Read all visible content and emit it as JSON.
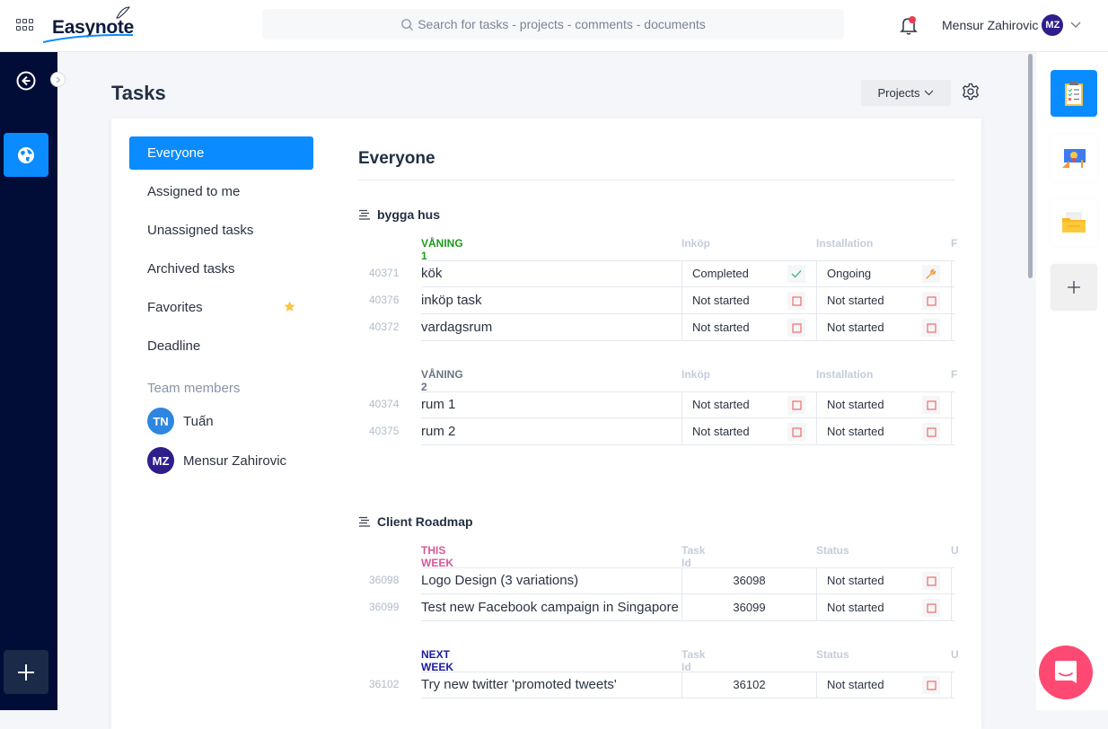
{
  "app": {
    "name": "Easynote",
    "search_placeholder": "Search for tasks - projects - comments - documents"
  },
  "user": {
    "name": "Mensur Zahirovic",
    "initials": "MZ",
    "has_notification": true
  },
  "page": {
    "title": "Tasks",
    "projects_label": "Projects"
  },
  "filters": {
    "items": [
      {
        "label": "Everyone",
        "active": true
      },
      {
        "label": "Assigned to me"
      },
      {
        "label": "Unassigned tasks"
      },
      {
        "label": "Archived tasks"
      },
      {
        "label": "Favorites",
        "icon": "star-icon"
      },
      {
        "label": "Deadline"
      }
    ],
    "team_label": "Team members",
    "members": [
      {
        "initials": "TN",
        "name": "Tuấn",
        "color": "#2f86e0"
      },
      {
        "initials": "MZ",
        "name": "Mensur Zahirovic",
        "color": "#2e1e8c"
      }
    ]
  },
  "main": {
    "title": "Everyone",
    "projects": [
      {
        "name": "bygga hus",
        "groups": [
          {
            "name": "VÅNING 1",
            "color": "#1e9a1e",
            "columns": [
              "Inköp",
              "Installation",
              "F"
            ],
            "rows": [
              {
                "id": "40371",
                "name": "kök",
                "cells": [
                  {
                    "text": "Completed",
                    "icon": "check-icon"
                  },
                  {
                    "text": "Ongoing",
                    "icon": "wrench-icon"
                  }
                ]
              },
              {
                "id": "40376",
                "name": "inköp task",
                "cells": [
                  {
                    "text": "Not started",
                    "icon": "square-icon"
                  },
                  {
                    "text": "Not started",
                    "icon": "square-icon"
                  }
                ]
              },
              {
                "id": "40372",
                "name": "vardagsrum",
                "cells": [
                  {
                    "text": "Not started",
                    "icon": "square-icon"
                  },
                  {
                    "text": "Not started",
                    "icon": "square-icon"
                  }
                ]
              }
            ]
          },
          {
            "name": "VÅNING 2",
            "color": "#6b7585",
            "columns": [
              "Inköp",
              "Installation",
              "F"
            ],
            "rows": [
              {
                "id": "40374",
                "name": "rum 1",
                "cells": [
                  {
                    "text": "Not started",
                    "icon": "square-icon"
                  },
                  {
                    "text": "Not started",
                    "icon": "square-icon"
                  }
                ]
              },
              {
                "id": "40375",
                "name": "rum 2",
                "cells": [
                  {
                    "text": "Not started",
                    "icon": "square-icon"
                  },
                  {
                    "text": "Not started",
                    "icon": "square-icon"
                  }
                ]
              }
            ]
          }
        ]
      },
      {
        "name": "Client Roadmap",
        "groups": [
          {
            "name": "THIS WEEK",
            "color": "#d6589a",
            "columns": [
              "Task Id",
              "Status",
              "U"
            ],
            "rows": [
              {
                "id": "36098",
                "name": "Logo Design (3 variations)",
                "cells": [
                  {
                    "text": "36098"
                  },
                  {
                    "text": "Not started",
                    "icon": "square-icon"
                  }
                ]
              },
              {
                "id": "36099",
                "name": "Test new Facebook campaign in Singapore",
                "cells": [
                  {
                    "text": "36099"
                  },
                  {
                    "text": "Not started",
                    "icon": "square-icon"
                  }
                ]
              }
            ]
          },
          {
            "name": "NEXT WEEK",
            "color": "#1c1c9c",
            "columns": [
              "Task Id",
              "Status",
              "U"
            ],
            "rows": [
              {
                "id": "36102",
                "name": "Try new twitter 'promoted tweets'",
                "cells": [
                  {
                    "text": "36102"
                  },
                  {
                    "text": "Not started",
                    "icon": "square-icon"
                  }
                ]
              }
            ]
          }
        ]
      }
    ]
  },
  "rightbar": {
    "apps": [
      {
        "name": "tasks-app",
        "icon": "clipboard-icon",
        "active": true
      },
      {
        "name": "ideas-app",
        "icon": "blueprint-icon"
      },
      {
        "name": "documents-app",
        "icon": "folder-icon"
      },
      {
        "name": "add-app",
        "icon": "plus-icon"
      }
    ]
  },
  "colors": {
    "accent": "#0a8bff",
    "nav_bg": "#010d36",
    "chat": "#fe4a73",
    "status_not_started": "#f06a6a",
    "status_completed": "#3cb87a",
    "status_ongoing": "#f49a3c"
  }
}
